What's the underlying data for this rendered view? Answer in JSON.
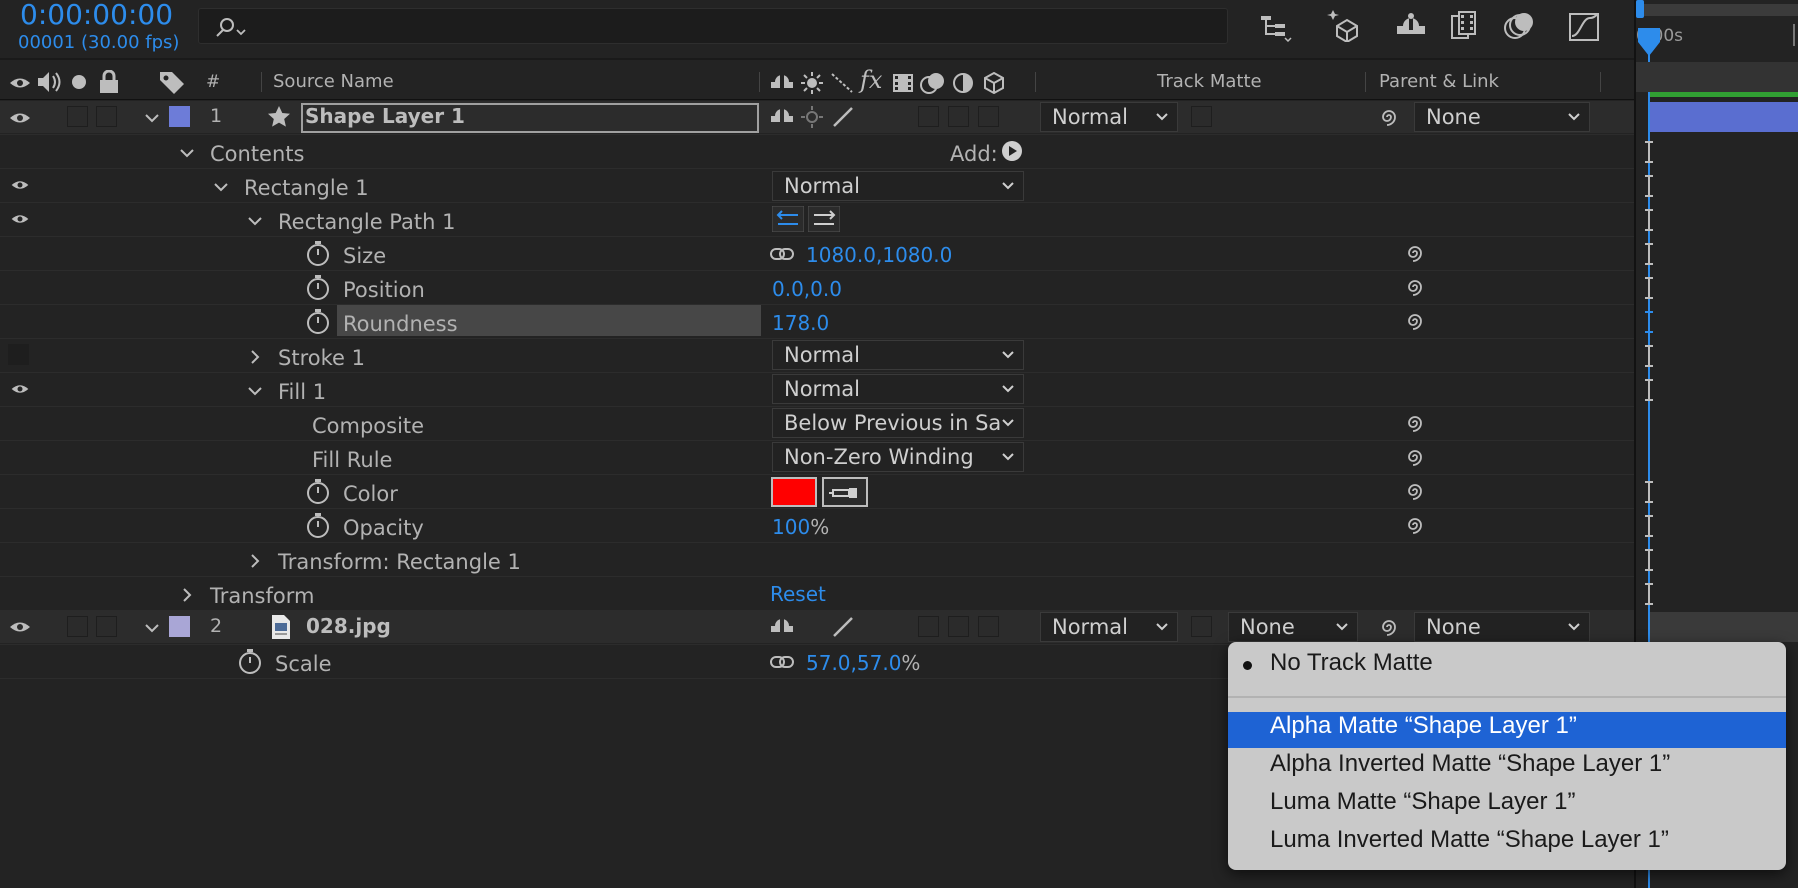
{
  "header": {
    "timecode": "0:00:00:00",
    "frame_info": "00001 (30.00 fps)",
    "search_placeholder": ""
  },
  "columns": {
    "hash": "#",
    "source_name": "Source Name",
    "track_matte": "Track Matte",
    "parent_link": "Parent & Link"
  },
  "ruler": {
    "label": "0:00s"
  },
  "layer1": {
    "num": "1",
    "name": "Shape Layer 1",
    "mode": "Normal",
    "parent": "None",
    "label_color": "#6d7cd8"
  },
  "rows": {
    "contents": "Contents",
    "add": "Add:",
    "rect1": "Rectangle 1",
    "rect1_mode": "Normal",
    "rectpath": "Rectangle Path 1",
    "size": "Size",
    "size_value": "1080.0,1080.0",
    "position": "Position",
    "position_value": "0.0,0.0",
    "roundness": "Roundness",
    "roundness_value": "178.0",
    "stroke": "Stroke 1",
    "stroke_mode": "Normal",
    "fill": "Fill 1",
    "fill_mode": "Normal",
    "composite": "Composite",
    "composite_value": "Below Previous in Sa",
    "fillrule": "Fill Rule",
    "fillrule_value": "Non-Zero Winding",
    "color": "Color",
    "color_value": "#ff0000",
    "opacity": "Opacity",
    "opacity_value": "100",
    "opacity_unit": "%",
    "transform_rect": "Transform: Rectangle 1",
    "transform": "Transform",
    "reset": "Reset"
  },
  "layer2": {
    "num": "2",
    "name": "028.jpg",
    "mode": "Normal",
    "track_matte": "None",
    "parent": "None",
    "label_color": "#a9a6d6",
    "scale": "Scale",
    "scale_value": "57.0,57.0",
    "scale_unit": "%"
  },
  "menu": {
    "items": [
      "No Track Matte",
      "Alpha Matte “Shape Layer 1”",
      "Alpha Inverted Matte “Shape Layer 1”",
      "Luma Matte “Shape Layer 1”",
      "Luma Inverted Matte “Shape Layer 1”"
    ],
    "selected": 1
  },
  "icons": [
    "search-icon",
    "flowchart-icon",
    "draft-3d-icon",
    "shy-icon",
    "frame-blending-icon",
    "motion-blur-icon",
    "graph-editor-icon",
    "eye-icon",
    "audio-icon",
    "solo-icon",
    "lock-icon",
    "label-icon",
    "star-icon",
    "link-icon",
    "spiral-icon",
    "stopwatch-icon",
    "eyedropper-icon",
    "play-circle-icon",
    "file-icon"
  ]
}
